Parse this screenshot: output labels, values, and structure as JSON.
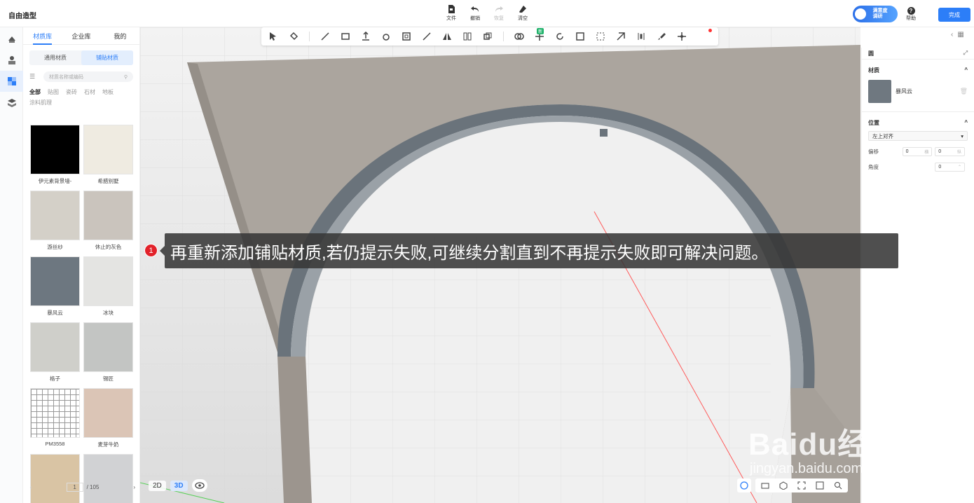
{
  "app": {
    "title": "自由造型"
  },
  "top_toolbar": {
    "file": "文件",
    "undo": "撤销",
    "redo": "恢复",
    "clear": "清空"
  },
  "survey_badge": {
    "line1": "满意度",
    "line2": "调研"
  },
  "help": {
    "label": "帮助"
  },
  "done_button": "完成",
  "material_panel": {
    "tabs": [
      {
        "label": "材质库",
        "active": true
      },
      {
        "label": "企业库",
        "active": false
      },
      {
        "label": "我的",
        "active": false
      }
    ],
    "subtabs": [
      {
        "label": "通用材质",
        "active": false
      },
      {
        "label": "铺贴材质",
        "active": true
      }
    ],
    "search_placeholder": "材质名称或编码",
    "categories": [
      "全部",
      "贴图",
      "瓷砖",
      "石材",
      "地板",
      "涂料肌理"
    ],
    "items": [
      {
        "name": "伊元素背景墙-",
        "color": "#000000"
      },
      {
        "name": "希腊别墅",
        "color": "#efebe1"
      },
      {
        "name": "游丝纱",
        "color": "#d4d0c8"
      },
      {
        "name": "休止的灰色",
        "color": "#cac4bd"
      },
      {
        "name": "暴风云",
        "color": "#6d7780"
      },
      {
        "name": "冰块",
        "color": "#e4e4e2"
      },
      {
        "name": "格子",
        "color": "#cfcfca"
      },
      {
        "name": "锡匠",
        "color": "#c3c5c3"
      },
      {
        "name": "PM3558",
        "color": "#ffffff"
      },
      {
        "name": "麦芽牛奶",
        "color": "#dbc5b6"
      },
      {
        "name": "",
        "color": "#d9c4a4"
      },
      {
        "name": "",
        "color": "#d1d2d4"
      }
    ],
    "pager": {
      "current": "1",
      "total": "/ 105"
    }
  },
  "viewport": {
    "view_2d": "2D",
    "view_3d": "3D",
    "new_tag": "新"
  },
  "properties": {
    "object_name": "圆",
    "material_section": "材质",
    "material_name": "暴风云",
    "position_section": "位置",
    "align_value": "左上对齐",
    "offset_label": "偏移",
    "offset_x": "0",
    "offset_x_unit": "横",
    "offset_y": "0",
    "offset_y_unit": "纵",
    "angle_label": "角度",
    "angle_value": "0"
  },
  "caption": {
    "step": "1",
    "text": "再重新添加铺贴材质,若仍提示失败,可继续分割直到不再提示失败即可解决问题。"
  },
  "watermark": {
    "main": "Baidu经验",
    "sub": "jingyan.baidu.com"
  },
  "colors": {
    "accent": "#2c7ef8",
    "caption_bg": "#373737",
    "step_red": "#e2222a"
  }
}
